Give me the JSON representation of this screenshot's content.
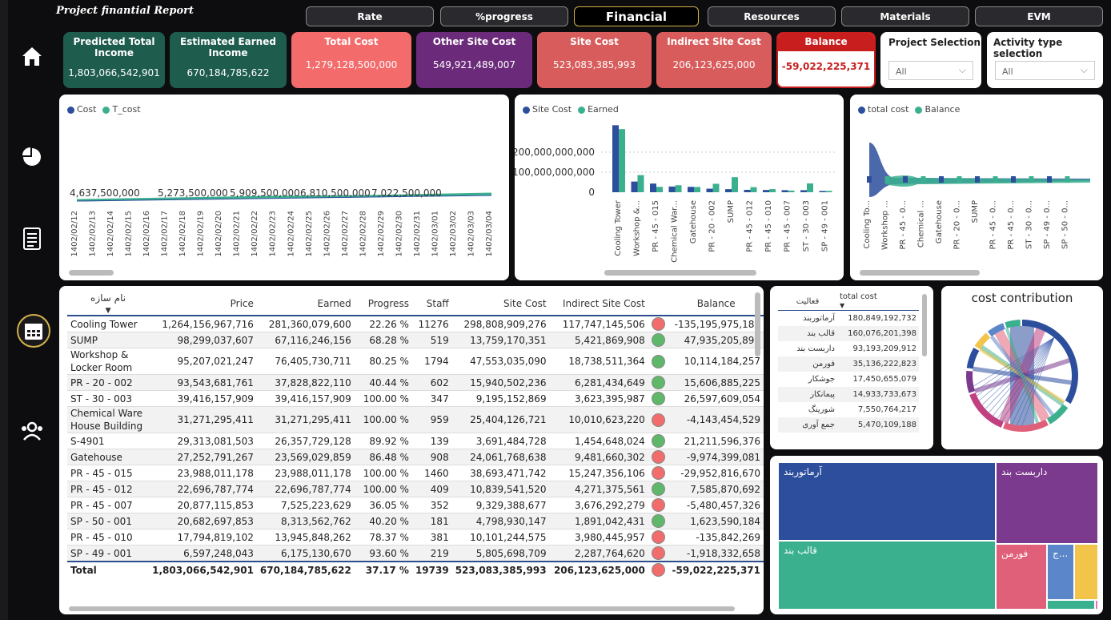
{
  "app": {
    "title": "Project finantial Report"
  },
  "tabs": [
    {
      "label": "Rate",
      "active": false
    },
    {
      "label": "%progress",
      "active": false
    },
    {
      "label": "Financial",
      "active": true
    },
    {
      "label": "Resources",
      "active": false
    },
    {
      "label": "Materials",
      "active": false
    },
    {
      "label": "EVM",
      "active": false
    }
  ],
  "sidebar": {
    "icons": [
      "home-icon",
      "pie-chart-icon",
      "report-icon",
      "calendar-icon",
      "team-icon"
    ]
  },
  "kpis": [
    {
      "label": "Predicted Total Income",
      "value": "1,803,066,542,901",
      "color": "#1e5c4e"
    },
    {
      "label": "Estimated Earned Income",
      "value": "670,184,785,622",
      "color": "#1e5c4e"
    },
    {
      "label": "Total Cost",
      "value": "1,279,128,500,000",
      "color": "#f36b6b"
    },
    {
      "label": "Other Site Cost",
      "value": "549,921,489,007",
      "color": "#6c2b7a"
    },
    {
      "label": "Site Cost",
      "value": "523,083,385,993",
      "color": "#d95c5c"
    },
    {
      "label": "Indirect Site Cost",
      "value": "206,123,625,000",
      "color": "#d95c5c"
    },
    {
      "label": "Balance",
      "value": "-59,022,225,371",
      "color": "#c81e1e"
    }
  ],
  "slicers": [
    {
      "label": "Project Selection",
      "value": "All"
    },
    {
      "label": "Activity type selection",
      "value": "All"
    }
  ],
  "chart1": {
    "legend": [
      {
        "name": "Cost",
        "color": "#2c4e9c"
      },
      {
        "name": "T_cost",
        "color": "#3bb08f"
      }
    ],
    "labels": [
      "4,637,500,000",
      "5,273,500,000",
      "5,909,500,000",
      "6,810,500,000",
      "7,022,500,000"
    ],
    "dates": [
      "1402/02/12",
      "1402/02/13",
      "1402/02/14",
      "1402/02/15",
      "1402/02/16",
      "1402/02/17",
      "1402/02/18",
      "1402/02/19",
      "1402/02/20",
      "1402/02/21",
      "1402/02/22",
      "1402/02/23",
      "1402/02/24",
      "1402/02/25",
      "1402/02/26",
      "1402/02/27",
      "1402/02/28",
      "1402/02/29",
      "1402/02/30",
      "1402/02/31",
      "1402/03/01",
      "1402/03/02",
      "1402/03/03",
      "1402/03/04"
    ]
  },
  "chart2": {
    "legend": [
      {
        "name": "Site Cost",
        "color": "#2c4e9c"
      },
      {
        "name": "Earned",
        "color": "#3bb08f"
      }
    ],
    "yticks": [
      "200,000,000,000",
      "100,000,000,000",
      "0"
    ],
    "categories": [
      "Cooling Tower",
      "Workshop &...",
      "PR - 45 - 015",
      "Chemical War...",
      "Gatehouse",
      "PR - 20 - 002",
      "SUMP",
      "PR - 45 - 012",
      "PR - 45 - 010",
      "PR - 45 - 007",
      "ST - 30 - 003",
      "SP - 49 - 001"
    ],
    "site_cost": [
      298.8,
      47.6,
      38.7,
      25.4,
      24.1,
      15.9,
      13.8,
      10.8,
      10.1,
      9.3,
      9.2,
      5.8
    ],
    "earned": [
      281.4,
      76.4,
      24.0,
      31.3,
      23.6,
      37.8,
      67.1,
      22.7,
      13.9,
      7.5,
      39.4,
      6.2
    ]
  },
  "chart3": {
    "legend": [
      {
        "name": "total cost",
        "color": "#2c4e9c"
      },
      {
        "name": "Balance",
        "color": "#3bb08f"
      }
    ],
    "categories": [
      "Cooling To...",
      "Workshop ...",
      "PR - 45 - 0...",
      "Chemical ...",
      "Gatehouse",
      "PR - 20 - 0...",
      "SUMP",
      "PR - 45 - 0...",
      "PR - 45 - 0...",
      "ST - 30 - 0...",
      "SP - 49 - 0...",
      "SP - 50 - 0..."
    ]
  },
  "table": {
    "headers": [
      "نام سازه",
      "Price",
      "Earned",
      "Progress",
      "Staff",
      "Site Cost",
      "Indirect Site Cost",
      "Balance"
    ],
    "rows": [
      {
        "name": "Cooling Tower",
        "price": "1,264,156,967,716",
        "earned": "281,360,079,600",
        "progress": "22.26 %",
        "staff": "11276",
        "site": "298,808,909,276",
        "indirect": "117,747,145,506",
        "status": "red",
        "balance": "-135,195,975,182"
      },
      {
        "name": "SUMP",
        "price": "98,299,037,607",
        "earned": "67,116,246,156",
        "progress": "68.28 %",
        "staff": "519",
        "site": "13,759,170,351",
        "indirect": "5,421,869,908",
        "status": "green",
        "balance": "47,935,205,898"
      },
      {
        "name": "Workshop & Locker Room",
        "price": "95,207,021,247",
        "earned": "76,405,730,711",
        "progress": "80.25 %",
        "staff": "1794",
        "site": "47,553,035,090",
        "indirect": "18,738,511,364",
        "status": "green",
        "balance": "10,114,184,257"
      },
      {
        "name": "PR - 20 - 002",
        "price": "93,543,681,761",
        "earned": "37,828,822,110",
        "progress": "40.44 %",
        "staff": "602",
        "site": "15,940,502,236",
        "indirect": "6,281,434,649",
        "status": "green",
        "balance": "15,606,885,225"
      },
      {
        "name": "ST - 30 - 003",
        "price": "39,416,157,909",
        "earned": "39,416,157,909",
        "progress": "100.00 %",
        "staff": "347",
        "site": "9,195,152,869",
        "indirect": "3,623,395,987",
        "status": "green",
        "balance": "26,597,609,054"
      },
      {
        "name": "Chemical Ware House Building",
        "price": "31,271,295,411",
        "earned": "31,271,295,411",
        "progress": "100.00 %",
        "staff": "959",
        "site": "25,404,126,721",
        "indirect": "10,010,623,220",
        "status": "red",
        "balance": "-4,143,454,529"
      },
      {
        "name": "S-4901",
        "price": "29,313,081,503",
        "earned": "26,357,729,128",
        "progress": "89.92 %",
        "staff": "139",
        "site": "3,691,484,728",
        "indirect": "1,454,648,024",
        "status": "green",
        "balance": "21,211,596,376"
      },
      {
        "name": "Gatehouse",
        "price": "27,252,791,267",
        "earned": "23,569,029,859",
        "progress": "86.48 %",
        "staff": "908",
        "site": "24,061,768,638",
        "indirect": "9,481,660,302",
        "status": "red",
        "balance": "-9,974,399,081"
      },
      {
        "name": "PR - 45 - 015",
        "price": "23,988,011,178",
        "earned": "23,988,011,178",
        "progress": "100.00 %",
        "staff": "1460",
        "site": "38,693,471,742",
        "indirect": "15,247,356,106",
        "status": "red",
        "balance": "-29,952,816,670"
      },
      {
        "name": "PR - 45 - 012",
        "price": "22,696,787,774",
        "earned": "22,696,787,774",
        "progress": "100.00 %",
        "staff": "409",
        "site": "10,839,541,520",
        "indirect": "4,271,375,561",
        "status": "green",
        "balance": "7,585,870,692"
      },
      {
        "name": "PR - 45 - 007",
        "price": "20,877,115,853",
        "earned": "7,525,223,629",
        "progress": "36.05 %",
        "staff": "352",
        "site": "9,329,388,677",
        "indirect": "3,676,292,279",
        "status": "red",
        "balance": "-5,480,457,326"
      },
      {
        "name": "SP - 50 - 001",
        "price": "20,682,697,853",
        "earned": "8,313,562,762",
        "progress": "40.20 %",
        "staff": "181",
        "site": "4,798,930,147",
        "indirect": "1,891,042,431",
        "status": "green",
        "balance": "1,623,590,184"
      },
      {
        "name": "PR - 45 - 010",
        "price": "17,794,819,102",
        "earned": "13,945,848,262",
        "progress": "78.37 %",
        "staff": "381",
        "site": "10,101,244,575",
        "indirect": "3,980,445,957",
        "status": "red",
        "balance": "-135,842,269"
      },
      {
        "name": "SP - 49 - 001",
        "price": "6,597,248,043",
        "earned": "6,175,130,670",
        "progress": "93.60 %",
        "staff": "219",
        "site": "5,805,698,709",
        "indirect": "2,287,764,620",
        "status": "red",
        "balance": "-1,918,332,658"
      }
    ],
    "total": {
      "name": "Total",
      "price": "1,803,066,542,901",
      "earned": "670,184,785,622",
      "progress": "37.17 %",
      "staff": "19739",
      "site": "523,083,385,993",
      "indirect": "206,123,625,000",
      "status": "red",
      "balance": "-59,022,225,371"
    }
  },
  "activity_table": {
    "headers": [
      "فعالیت",
      "total cost"
    ],
    "rows": [
      {
        "name": "آرماتوربند",
        "value": "180,849,192,732"
      },
      {
        "name": "قالب بند",
        "value": "160,076,201,398"
      },
      {
        "name": "داربست بند",
        "value": "93,193,209,912"
      },
      {
        "name": "فورمن",
        "value": "35,136,222,823"
      },
      {
        "name": "جوشکار",
        "value": "17,450,655,079"
      },
      {
        "name": "پیمانکار",
        "value": "14,933,733,673"
      },
      {
        "name": "شورینگ",
        "value": "7,550,764,217"
      },
      {
        "name": "جمع آوری",
        "value": "5,470,109,188"
      }
    ]
  },
  "cost_contribution": {
    "title": "cost contribution"
  },
  "treemap": {
    "items": [
      {
        "label": "آرماتوربند",
        "color": "#2c4e9c"
      },
      {
        "label": "داربست بند",
        "color": "#7b3a8e"
      },
      {
        "label": "قالب بند",
        "color": "#3bb08f"
      },
      {
        "label": "فورمن",
        "color": "#e0607a"
      },
      {
        "label": "ج...",
        "color": "#5b86c9"
      },
      {
        "label": "",
        "color": "#f2c54a"
      }
    ]
  }
}
